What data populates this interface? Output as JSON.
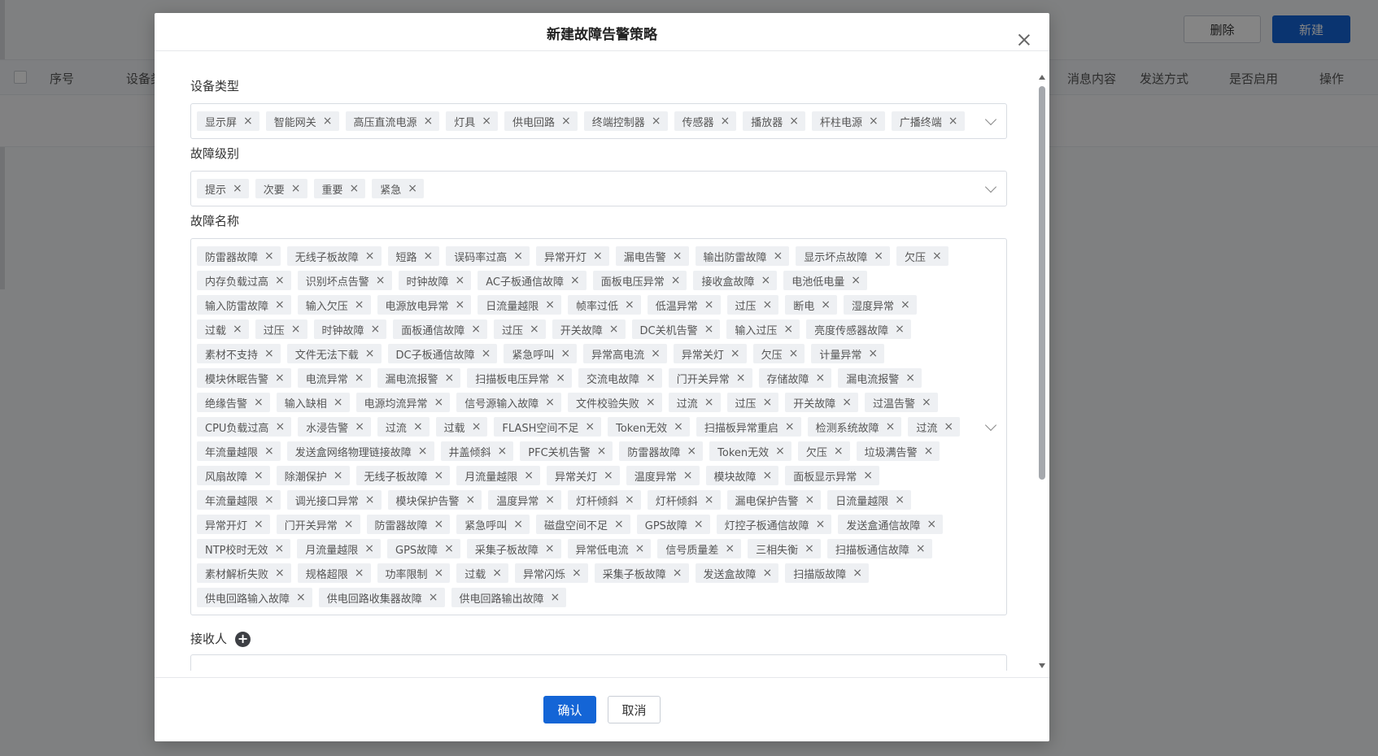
{
  "background": {
    "delete_label": "删除",
    "new_label": "新建",
    "columns": [
      "序号",
      "设备类",
      "消息内容",
      "发送方式",
      "是否启用",
      "操作"
    ]
  },
  "modal": {
    "title": "新建故障告警策略",
    "device_type": {
      "label": "设备类型",
      "tags": [
        "显示屏",
        "智能网关",
        "高压直流电源",
        "灯具",
        "供电回路",
        "终端控制器",
        "传感器",
        "播放器",
        "杆柱电源",
        "广播终端"
      ]
    },
    "fault_level": {
      "label": "故障级别",
      "tags": [
        "提示",
        "次要",
        "重要",
        "紧急"
      ]
    },
    "fault_name": {
      "label": "故障名称",
      "tags": [
        "防雷器故障",
        "无线子板故障",
        "短路",
        "误码率过高",
        "异常开灯",
        "漏电告警",
        "输出防雷故障",
        "显示坏点故障",
        "欠压",
        "内存负载过高",
        "识别坏点告警",
        "时钟故障",
        "AC子板通信故障",
        "面板电压异常",
        "接收盒故障",
        "电池低电量",
        "输入防雷故障",
        "输入欠压",
        "电源放电异常",
        "日流量越限",
        "帧率过低",
        "低温异常",
        "过压",
        "断电",
        "湿度异常",
        "过载",
        "过压",
        "时钟故障",
        "面板通信故障",
        "过压",
        "开关故障",
        "DC关机告警",
        "输入过压",
        "亮度传感器故障",
        "素材不支持",
        "文件无法下载",
        "DC子板通信故障",
        "紧急呼叫",
        "异常高电流",
        "异常关灯",
        "欠压",
        "计量异常",
        "模块休眠告警",
        "电流异常",
        "漏电流报警",
        "扫描板电压异常",
        "交流电故障",
        "门开关异常",
        "存储故障",
        "漏电流报警",
        "绝缘告警",
        "输入缺相",
        "电源均流异常",
        "信号源输入故障",
        "文件校验失败",
        "过流",
        "过压",
        "开关故障",
        "过温告警",
        "CPU负载过高",
        "水浸告警",
        "过流",
        "过载",
        "FLASH空间不足",
        "Token无效",
        "扫描板异常重启",
        "检测系统故障",
        "过流",
        "年流量越限",
        "发送盒网络物理链接故障",
        "井盖倾斜",
        "PFC关机告警",
        "防雷器故障",
        "Token无效",
        "欠压",
        "垃圾满告警",
        "风扇故障",
        "除潮保护",
        "无线子板故障",
        "月流量越限",
        "异常关灯",
        "温度异常",
        "模块故障",
        "面板显示异常",
        "年流量越限",
        "调光接口异常",
        "模块保护告警",
        "温度异常",
        "灯杆倾斜",
        "灯杆倾斜",
        "漏电保护告警",
        "日流量越限",
        "异常开灯",
        "门开关异常",
        "防雷器故障",
        "紧急呼叫",
        "磁盘空间不足",
        "GPS故障",
        "灯控子板通信故障",
        "发送盒通信故障",
        "NTP校时无效",
        "月流量越限",
        "GPS故障",
        "采集子板故障",
        "异常低电流",
        "信号质量差",
        "三相失衡",
        "扫描板通信故障",
        "素材解析失败",
        "规格超限",
        "功率限制",
        "过载",
        "异常闪烁",
        "采集子板故障",
        "发送盒故障",
        "扫描版故障",
        "供电回路输入故障",
        "供电回路收集器故障",
        "供电回路输出故障"
      ]
    },
    "receiver": {
      "label": "接收人"
    },
    "confirm_label": "确认",
    "cancel_label": "取消"
  }
}
